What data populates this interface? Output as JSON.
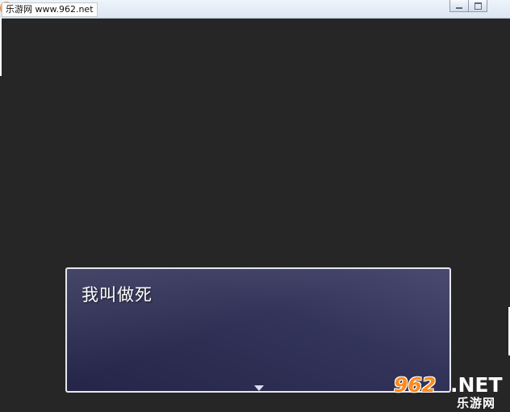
{
  "titlebar": {
    "watermark": "乐游网 www.962.net"
  },
  "dialog": {
    "message": "我叫做死"
  },
  "logo": {
    "number": "962",
    "suffix": ".NET",
    "sub": "乐游网"
  },
  "colors": {
    "background": "#262626",
    "dialog_top": "#4a4a70",
    "dialog_bottom": "#252549",
    "dialog_border": "#e6e6ee",
    "logo_orange": "#ff8a1a"
  }
}
